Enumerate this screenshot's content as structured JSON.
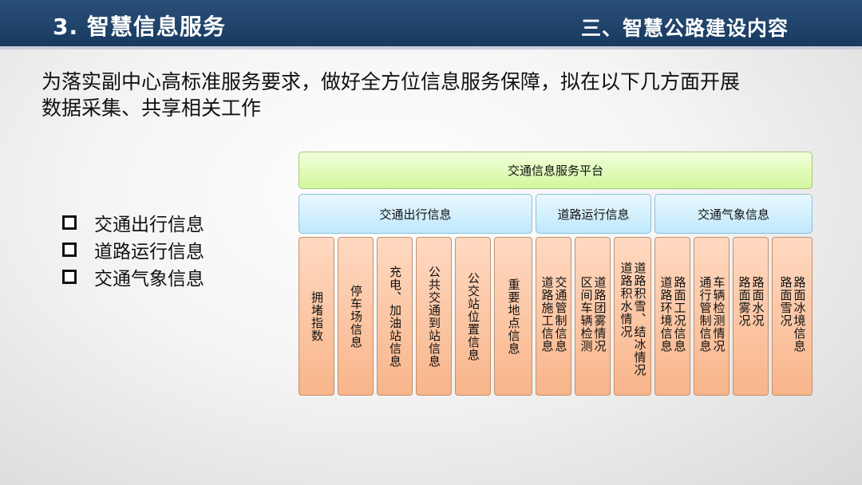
{
  "header": {
    "title": "3. 智慧信息服务",
    "section": "三、智慧公路建设内容"
  },
  "intro": {
    "line1": "为落实副中心高标准服务要求，做好全方位信息服务保障，拟在以下几方面开展",
    "line2": "数据采集、共享相关工作"
  },
  "bullets": [
    "交通出行信息",
    "道路运行信息",
    "交通气象信息"
  ],
  "diagram": {
    "platform": "交通信息服务平台",
    "categories": [
      "交通出行信息",
      "道路运行信息",
      "交通气象信息"
    ],
    "travel_items": [
      "拥堵指数",
      "停车场信息",
      "充电、加油站信息",
      "公共交通到站信息",
      "公交站位置信息",
      "重要地点信息"
    ],
    "road_items": [
      "道路施工信息",
      "交通管制信息",
      "区间车辆检测",
      "道路团雾情况",
      "道路积水情况",
      "道路积雪、结冰情况"
    ],
    "weather_items": [
      "道路环境信息",
      "路面工况信息",
      "通行管制信息",
      "车辆检测情况",
      "路面雾况",
      "路面水况",
      "路面雪况",
      "路面冰境信息"
    ]
  },
  "colors": {
    "header_bg": "#1f4570",
    "platform_fill": "#d8f8a8",
    "category_fill": "#c8ecfb",
    "item_fill": "#fbc7a4"
  }
}
